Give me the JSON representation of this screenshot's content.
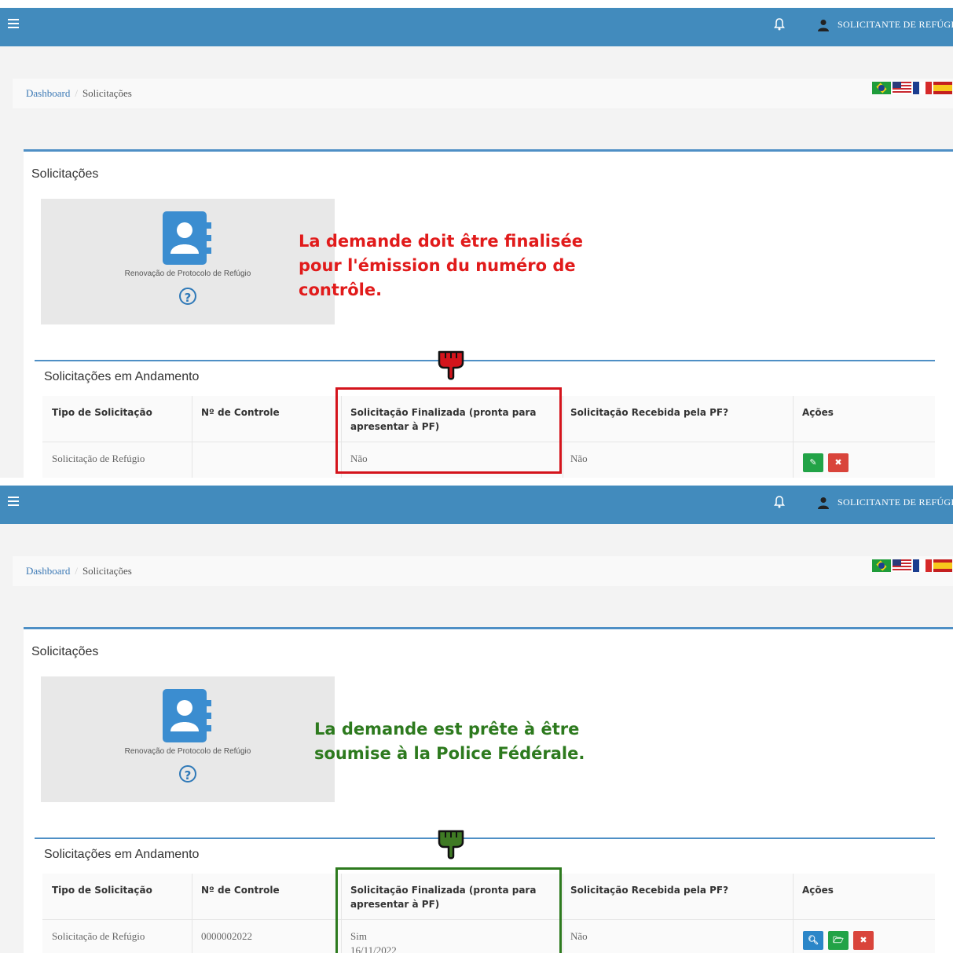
{
  "topbar": {
    "user_label": "SOLICITANTE DE REFÚGI"
  },
  "breadcrumb": {
    "home": "Dashboard",
    "separator": "/",
    "current": "Solicitações"
  },
  "card_title": "Solicitações",
  "service_tile": {
    "label": "Renovação de Protocolo de Refúgio",
    "help": "?"
  },
  "in_progress_title": "Solicitações em Andamento",
  "table_headers": {
    "type": "Tipo de Solicitação",
    "control": "Nº de Controle",
    "finalized": "Solicitação Finalizada (pronta para apresentar à PF)",
    "received": "Solicitação Recebida pela PF?",
    "actions": "Ações"
  },
  "panel1": {
    "annotation": "La demande doit être finalisée pour l'émission du numéro de contrôle.",
    "row": {
      "type": "Solicitação de Refúgio",
      "control": "",
      "finalized": "Não",
      "finalized_date": "",
      "received": "Não"
    }
  },
  "panel2": {
    "annotation": "La demande est prête à être soumise à la Police Fédérale.",
    "row": {
      "type": "Solicitação de Refúgio",
      "control": "0000002022",
      "finalized": "Sim",
      "finalized_date": "16/11/2022",
      "received": "Não"
    }
  },
  "colors": {
    "topbar": "#428bbd",
    "annotation_red": "#e11b1b",
    "annotation_green": "#2d7a1e"
  }
}
